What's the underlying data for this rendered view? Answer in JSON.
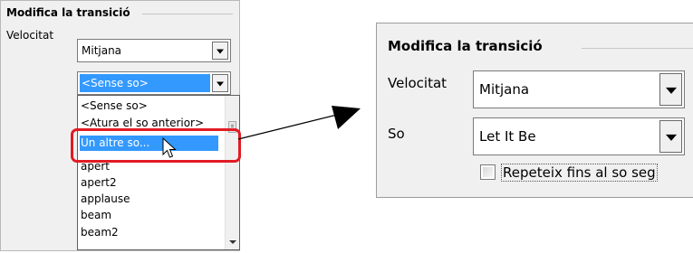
{
  "left_panel": {
    "group_title": "Modifica la transició",
    "speed_label": "Velocitat",
    "speed_value": "Mitjana",
    "sound_value": "<Sense so>",
    "dropdown_items": [
      "<Sense so>",
      "<Atura el so anterior>",
      "Un altre so...",
      "apert",
      "apert2",
      "applause",
      "beam",
      "beam2"
    ],
    "selected_index": 2
  },
  "right_panel": {
    "group_title": "Modifica la transició",
    "speed_label": "Velocitat",
    "speed_value": "Mitjana",
    "sound_label": "So",
    "sound_value": "Let It Be",
    "repeat_checkbox_label": "Repeteix fins al so seg",
    "repeat_checked": false
  },
  "colors": {
    "highlight_border": "#e21b24",
    "selection": "#3399ff"
  },
  "icons": {
    "cursor": "mouse-pointer-icon",
    "arrow": "callout-arrow-icon"
  }
}
